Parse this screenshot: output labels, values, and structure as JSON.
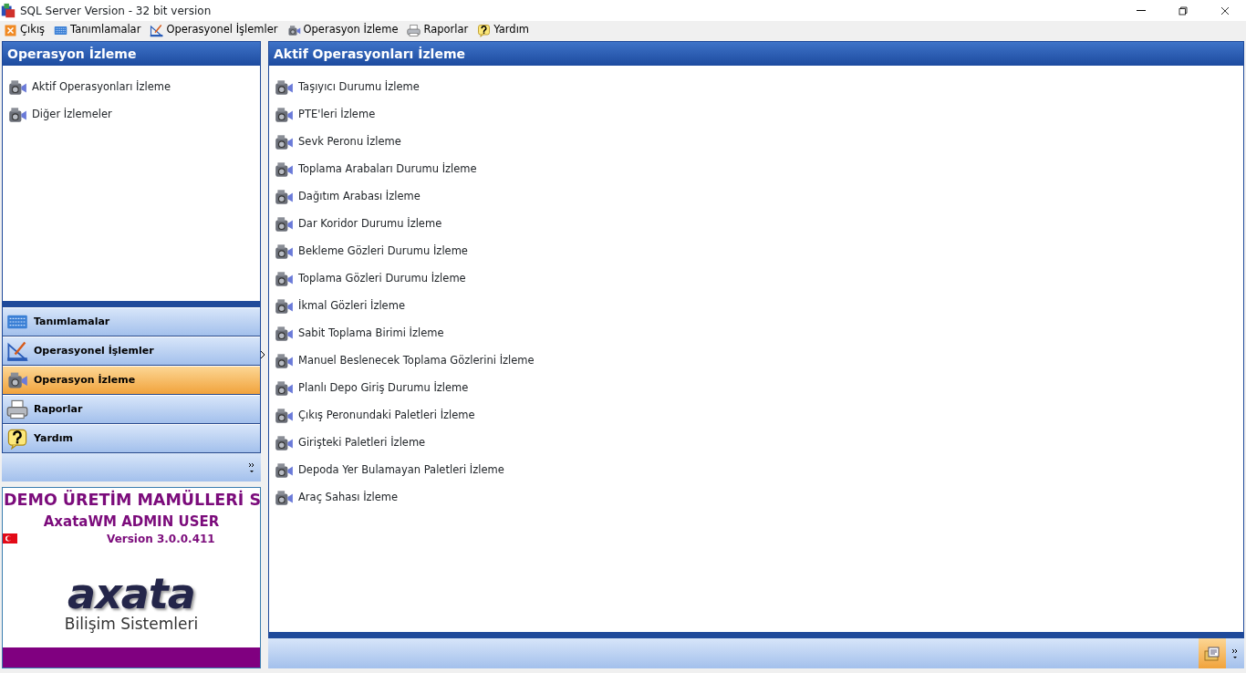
{
  "window": {
    "title": "SQL Server Version - 32 bit version"
  },
  "menu": [
    {
      "label": "Çıkış"
    },
    {
      "label": "Tanımlamalar"
    },
    {
      "label": "Operasyonel İşlemler"
    },
    {
      "label": "Operasyon İzleme"
    },
    {
      "label": "Raporlar"
    },
    {
      "label": "Yardım"
    }
  ],
  "left_panel": {
    "title": "Operasyon İzleme",
    "items": [
      {
        "label": "Aktif Operasyonları İzleme"
      },
      {
        "label": "Diğer İzlemeler"
      }
    ]
  },
  "nav_buttons": [
    {
      "label": "Tanımlamalar",
      "selected": false
    },
    {
      "label": "Operasyonel İşlemler",
      "selected": false
    },
    {
      "label": "Operasyon İzleme",
      "selected": true
    },
    {
      "label": "Raporlar",
      "selected": false
    },
    {
      "label": "Yardım",
      "selected": false
    }
  ],
  "info": {
    "company": "DEMO ÜRETİM MAMÜLLERİ S",
    "user": "AxataWM ADMIN USER",
    "version": "Version 3.0.0.411",
    "logo": "axata",
    "logo_subtitle": "Bilişim Sistemleri"
  },
  "right_panel": {
    "title": "Aktif Operasyonları İzleme",
    "items": [
      {
        "label": "Taşıyıcı Durumu İzleme"
      },
      {
        "label": "PTE'leri İzleme"
      },
      {
        "label": "Sevk Peronu İzleme"
      },
      {
        "label": "Toplama Arabaları Durumu İzleme"
      },
      {
        "label": "Dağıtım Arabası İzleme"
      },
      {
        "label": "Dar Koridor Durumu İzleme"
      },
      {
        "label": "Bekleme Gözleri Durumu İzleme"
      },
      {
        "label": "Toplama Gözleri Durumu İzleme"
      },
      {
        "label": "İkmal Gözleri İzleme"
      },
      {
        "label": "Sabit Toplama Birimi İzleme"
      },
      {
        "label": "Manuel Beslenecek Toplama Gözlerini İzleme"
      },
      {
        "label": "Planlı Depo Giriş Durumu İzleme"
      },
      {
        "label": "Çıkış Peronundaki Paletleri İzleme"
      },
      {
        "label": "Girişteki Paletleri İzleme"
      },
      {
        "label": "Depoda Yer Bulamayan Paletleri İzleme"
      },
      {
        "label": "Araç Sahası İzleme"
      }
    ]
  }
}
